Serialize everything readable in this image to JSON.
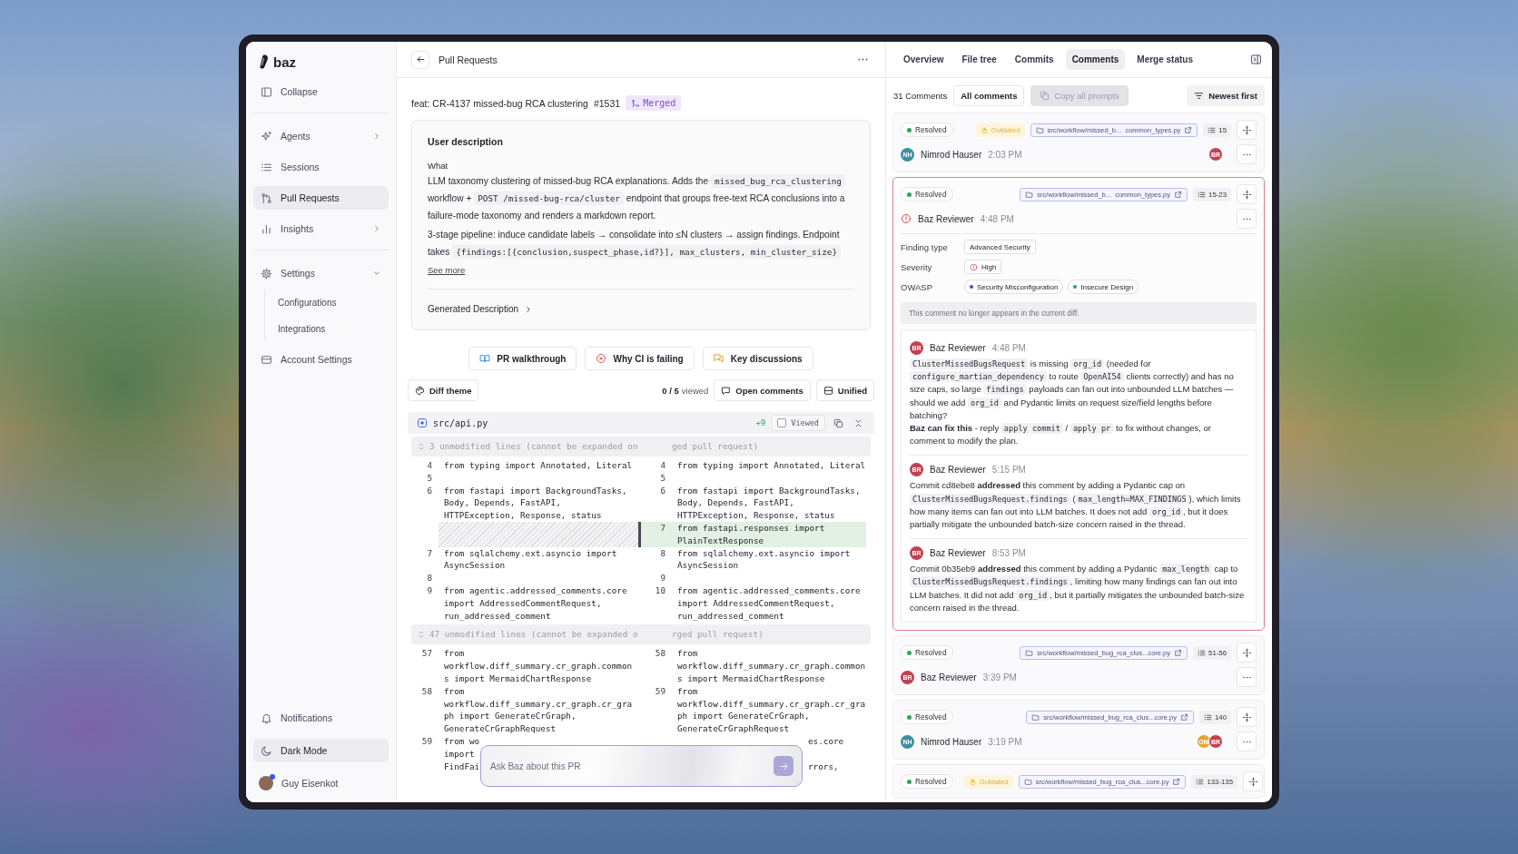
{
  "sidebar": {
    "logo": "baz",
    "collapse": "Collapse",
    "nav": [
      {
        "label": "Agents",
        "expanded": false,
        "selected": false
      },
      {
        "label": "Sessions",
        "selected": false
      },
      {
        "label": "Pull Requests",
        "selected": true
      },
      {
        "label": "Insights",
        "expanded": false,
        "selected": false
      }
    ],
    "nav2": [
      {
        "label": "Settings",
        "expanded": true,
        "selected": false,
        "children": [
          {
            "label": "Configurations",
            "selected": false
          },
          {
            "label": "Integrations",
            "selected": false
          }
        ]
      },
      {
        "label": "Account Settings",
        "selected": false
      }
    ],
    "footer": [
      {
        "label": "Notifications",
        "selected": false
      },
      {
        "label": "Dark Mode",
        "selected": true
      }
    ],
    "user": {
      "name": "Guy Eisenkot",
      "status_dot": true
    }
  },
  "pr": {
    "header_title": "Pull Requests",
    "title": "feat: CR-4137 missed-bug RCA clustering",
    "number": "#1531",
    "status": "Merged",
    "description": {
      "heading": "User description",
      "subheading": "What",
      "paragraphs": [
        [
          {
            "kind": "text",
            "text": "LLM taxonomy clustering of missed-bug RCA explanations. Adds the "
          },
          {
            "kind": "code",
            "text": "missed_bug_rca_clustering"
          },
          {
            "kind": "text",
            "text": " workflow + "
          },
          {
            "kind": "code",
            "text": "POST /missed-bug-rca/cluster"
          },
          {
            "kind": "text",
            "text": " endpoint that groups free-text RCA conclusions into a failure-mode taxonomy and renders a markdown report."
          }
        ],
        [
          {
            "kind": "text",
            "text": "3-stage pipeline: induce candidate labels → consolidate into ≤N clusters → assign findings. Endpoint takes "
          },
          {
            "kind": "code",
            "text": "{findings:[{conclusion,suspect_phase,id?}], max_clusters, min_cluster_size}"
          }
        ]
      ],
      "see_more": "See more",
      "generated": "Generated Description"
    },
    "actions": [
      {
        "label": "PR walkthrough"
      },
      {
        "label": "Why CI is failing"
      },
      {
        "label": "Key discussions"
      }
    ],
    "toolbar": {
      "diff_theme": "Diff theme",
      "viewed_count": "0 / 5",
      "viewed_label": "viewed",
      "open_comments": "Open comments",
      "view_mode": "Unified"
    },
    "file": {
      "path": "src/api.py",
      "additions": "+9",
      "viewed_label": "Viewed",
      "viewed": false
    },
    "diff": [
      {
        "kind": "collapsed",
        "left": "3 unmodified lines (cannot be expanded on",
        "right": "ged pull request)"
      },
      {
        "kind": "context",
        "left_num": "4",
        "left": "from typing import Annotated, Literal",
        "right_num": "4",
        "right": "from typing import Annotated, Literal"
      },
      {
        "kind": "context",
        "left_num": "5",
        "right_num": "5"
      },
      {
        "kind": "context",
        "left_num": "6",
        "left": "from fastapi import BackgroundTasks, Body, Depends, FastAPI, HTTPException, Response, status",
        "right_num": "6",
        "right": "from fastapi import BackgroundTasks, Body, Depends, FastAPI, HTTPException, Response, status"
      },
      {
        "kind": "added",
        "right_num": "7",
        "right": "from fastapi.responses import PlainTextResponse"
      },
      {
        "kind": "context",
        "left_num": "7",
        "left": "from sqlalchemy.ext.asyncio import AsyncSession",
        "right_num": "8",
        "right": "from sqlalchemy.ext.asyncio import AsyncSession"
      },
      {
        "kind": "context",
        "left_num": "8",
        "right_num": "9"
      },
      {
        "kind": "context",
        "left_num": "9",
        "left": "from agentic.addressed_comments.core import AddressedCommentRequest, run_addressed_comment",
        "right_num": "10",
        "right": "from agentic.addressed_comments.core import AddressedCommentRequest, run_addressed_comment"
      },
      {
        "kind": "collapsed",
        "left": "47 unmodified lines (cannot be expanded o",
        "right": "rged pull request)"
      },
      {
        "kind": "context",
        "left_num": "57",
        "left": "from workflow.diff_summary.cr_graph.commons import MermaidChartResponse",
        "right_num": "58",
        "right": "from workflow.diff_summary.cr_graph.commons import MermaidChartResponse"
      },
      {
        "kind": "context",
        "left_num": "58",
        "left": "from workflow.diff_summary.cr_graph.cr_graph import GenerateCrGraph, GenerateCrGraphRequest",
        "right_num": "59",
        "right": "from workflow.diff_summary.cr_graph.cr_graph import GenerateCrGraph, GenerateCrGraphRequest"
      },
      {
        "kind": "clipped",
        "left_num": "59",
        "left": "from wo\nimport\nFindFai",
        "right": "es.core\n\nrrors,"
      }
    ],
    "ask": {
      "placeholder": "Ask Baz about this PR"
    }
  },
  "comments_panel": {
    "tabs": [
      {
        "label": "Overview",
        "selected": false
      },
      {
        "label": "File tree",
        "selected": false
      },
      {
        "label": "Commits",
        "selected": false
      },
      {
        "label": "Comments",
        "selected": true
      },
      {
        "label": "Merge status",
        "selected": false
      }
    ],
    "count": "31 Comments",
    "filter": "All comments",
    "copy_prompts": {
      "label": "Copy all prompts",
      "disabled": true
    },
    "sort": "Newest first",
    "threads": [
      {
        "highlighted": false,
        "status": "Resolved",
        "tag": "Outdated",
        "file": "src/workflow/missed_b...  common_types.py",
        "lines": "15",
        "author": {
          "kind": "avatar",
          "initials": "NH",
          "color": "#3b8fa3",
          "name": "Nimrod Hauser"
        },
        "time": "2:03 PM",
        "reviewers": [
          {
            "initials": "BR",
            "color": "#c2414f"
          }
        ]
      },
      {
        "highlighted": true,
        "status": "Resolved",
        "file": "src/workflow/missed_b...  common_types.py",
        "lines": "15-23",
        "author": {
          "kind": "alert",
          "name": "Baz Reviewer"
        },
        "time": "4:48 PM",
        "fields": [
          {
            "label": "Finding type",
            "values": [
              {
                "kind": "plain",
                "text": "Advanced Security"
              }
            ]
          },
          {
            "label": "Severity",
            "values": [
              {
                "kind": "severity",
                "text": "High"
              }
            ]
          },
          {
            "label": "OWASP",
            "values": [
              {
                "kind": "dot",
                "text": "Security Misconfiguration",
                "color": "#3552d6"
              },
              {
                "kind": "dot",
                "text": "Insecure Design",
                "color": "#2a9a97"
              }
            ]
          }
        ],
        "notice": "This comment no longer appears in the current diff.",
        "replies": [
          {
            "initials": "BR",
            "color": "#c2414f",
            "name": "Baz Reviewer",
            "time": "4:48 PM",
            "paragraphs": [
              [
                {
                  "kind": "code",
                  "text": "ClusterMissedBugsRequest"
                },
                {
                  "kind": "text",
                  "text": " is missing "
                },
                {
                  "kind": "code",
                  "text": "org_id"
                },
                {
                  "kind": "text",
                  "text": " (needed for "
                },
                {
                  "kind": "code",
                  "text": "configure_martian_dependency"
                },
                {
                  "kind": "text",
                  "text": " to route "
                },
                {
                  "kind": "code",
                  "text": "OpenAI54"
                },
                {
                  "kind": "text",
                  "text": " clients correctly) and has no size caps, so large "
                },
                {
                  "kind": "code",
                  "text": "findings"
                },
                {
                  "kind": "text",
                  "text": " payloads can fan out into unbounded LLM batches — should we add "
                },
                {
                  "kind": "code",
                  "text": "org_id"
                },
                {
                  "kind": "text",
                  "text": " and Pydantic limits on request size/field lengths before batching?"
                }
              ],
              [
                {
                  "kind": "bold",
                  "text": "Baz can fix this"
                },
                {
                  "kind": "text",
                  "text": " - reply "
                },
                {
                  "kind": "code",
                  "text": "apply commit"
                },
                {
                  "kind": "text",
                  "text": " / "
                },
                {
                  "kind": "code",
                  "text": "apply pr"
                },
                {
                  "kind": "text",
                  "text": " to fix without changes, or comment to modify the plan."
                }
              ]
            ]
          },
          {
            "initials": "BR",
            "color": "#c2414f",
            "name": "Baz Reviewer",
            "time": "5:15 PM",
            "paragraphs": [
              [
                {
                  "kind": "text",
                  "text": "Commit cd8ebe8 "
                },
                {
                  "kind": "bold",
                  "text": "addressed"
                },
                {
                  "kind": "text",
                  "text": " this comment by adding a Pydantic cap on "
                },
                {
                  "kind": "code",
                  "text": "ClusterMissedBugsRequest.findings"
                },
                {
                  "kind": "text",
                  "text": " ("
                },
                {
                  "kind": "code",
                  "text": "max_length=MAX_FINDINGS"
                },
                {
                  "kind": "text",
                  "text": "), which limits how many items can fan out into LLM batches. It does not add "
                },
                {
                  "kind": "code",
                  "text": "org_id"
                },
                {
                  "kind": "text",
                  "text": ", but it does partially mitigate the unbounded batch-size concern raised in the thread."
                }
              ]
            ]
          },
          {
            "initials": "BR",
            "color": "#c2414f",
            "name": "Baz Reviewer",
            "time": "8:53 PM",
            "paragraphs": [
              [
                {
                  "kind": "text",
                  "text": "Commit 0b35eb9 "
                },
                {
                  "kind": "bold",
                  "text": "addressed"
                },
                {
                  "kind": "text",
                  "text": " this comment by adding a Pydantic "
                },
                {
                  "kind": "code",
                  "text": "max_length"
                },
                {
                  "kind": "text",
                  "text": " cap to "
                },
                {
                  "kind": "code",
                  "text": "ClusterMissedBugsRequest.findings"
                },
                {
                  "kind": "text",
                  "text": ", limiting how many findings can fan out into LLM batches. It did not add "
                },
                {
                  "kind": "code",
                  "text": "org_id"
                },
                {
                  "kind": "text",
                  "text": ", but it partially mitigates the unbounded batch-size concern raised in the thread."
                }
              ]
            ]
          }
        ]
      },
      {
        "highlighted": false,
        "status": "Resolved",
        "file": "src/workflow/missed_bug_rca_clus...core.py",
        "lines": "51-56",
        "author": {
          "kind": "avatar",
          "initials": "BR",
          "color": "#c2414f",
          "name": "Baz Reviewer"
        },
        "time": "3:39 PM"
      },
      {
        "highlighted": false,
        "status": "Resolved",
        "file": "src/workflow/missed_bug_rca_clus...core.py",
        "lines": "140",
        "author": {
          "kind": "avatar",
          "initials": "NH",
          "color": "#3b8fa3",
          "name": "Nimrod Hauser"
        },
        "time": "3:19 PM",
        "reviewers": [
          {
            "initials": "OM",
            "color": "#e2a43a"
          },
          {
            "initials": "BR",
            "color": "#c2414f"
          }
        ]
      },
      {
        "highlighted": false,
        "status": "Resolved",
        "tag": "Outdated",
        "file": "src/workflow/missed_bug_rca_clus...core.py",
        "lines": "133-135"
      }
    ]
  }
}
